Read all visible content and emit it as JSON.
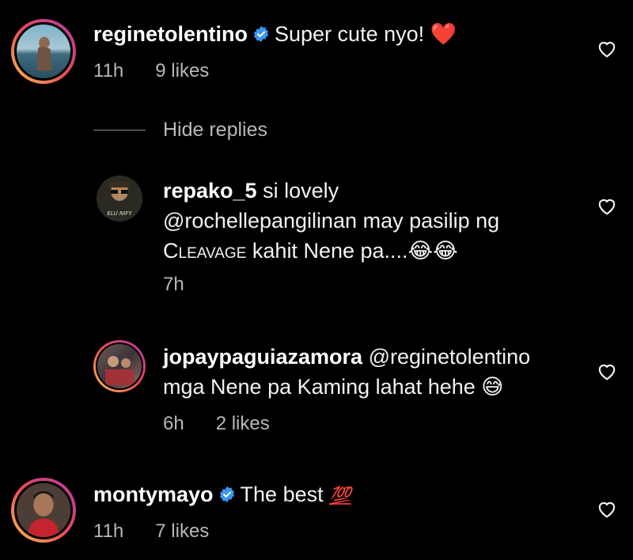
{
  "comments": [
    {
      "username": "reginetolentino",
      "verified": true,
      "text": "Super cute nyo!",
      "emoji": "❤️",
      "time": "11h",
      "likes": "9 likes"
    },
    {
      "username": "montymayo",
      "verified": true,
      "text": "The best",
      "emoji": "💯",
      "time": "11h",
      "likes": "7 likes"
    }
  ],
  "hide_replies_label": "Hide replies",
  "replies": [
    {
      "username": "repako_5",
      "text_line1": "si lovely",
      "text_line2": "@rochellepangilinan may pasilip ng",
      "text_line3_caps": "Cleavage",
      "text_line3_rest": "kahit Nene pa....",
      "emoji": "😂😂",
      "time": "7h"
    },
    {
      "username": "jopaypaguiazamora",
      "mention": "@reginetolentino",
      "text_line2": "mga Nene pa Kaming lahat hehe",
      "emoji": "😅",
      "time": "6h",
      "likes": "2 likes"
    }
  ],
  "colors": {
    "background": "#000000",
    "text": "#f2f2f2",
    "meta": "#b8b8b8",
    "verified": "#3897f0",
    "heart_emoji": "#e8233f"
  }
}
